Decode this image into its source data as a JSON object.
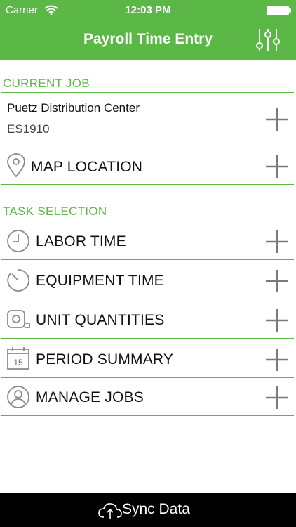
{
  "status_bar": {
    "carrier": "Carrier",
    "time": "12:03 PM"
  },
  "nav": {
    "title": "Payroll Time Entry"
  },
  "current_job": {
    "header": "CURRENT JOB",
    "job_name": "Puetz Distribution Center",
    "job_code": "ES1910",
    "map_location_label": "MAP LOCATION"
  },
  "task_selection": {
    "header": "TASK SELECTION",
    "items": [
      {
        "label": "LABOR TIME",
        "icon": "clock-icon"
      },
      {
        "label": "EQUIPMENT TIME",
        "icon": "timer-icon"
      },
      {
        "label": "UNIT QUANTITIES",
        "icon": "tape-measure-icon"
      },
      {
        "label": "PERIOD SUMMARY",
        "icon": "calendar-icon",
        "calendar_day": "15"
      },
      {
        "label": "MANAGE JOBS",
        "icon": "user-icon"
      }
    ]
  },
  "footer": {
    "sync_label": "Sync Data"
  },
  "colors": {
    "accent": "#5cb846",
    "footer_bg": "#000000",
    "text": "#111111",
    "icon_gray": "#8a8a8a"
  }
}
